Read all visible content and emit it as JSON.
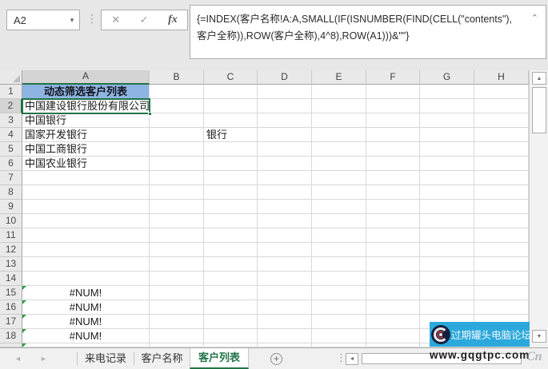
{
  "window": {
    "name_box": "A2"
  },
  "formula_bar": {
    "formula": "{=INDEX(客户名称!A:A,SMALL(IF(ISNUMBER(FIND(CELL(\"contents\"),客户全称)),ROW(客户全称),4^8),ROW(A1)))&\"\"}"
  },
  "sheet": {
    "columns": [
      "A",
      "B",
      "C",
      "D",
      "E",
      "F",
      "G",
      "H"
    ],
    "visible_rows": 18,
    "selected_cell": "A2",
    "selected_column": "A",
    "selected_row": 2,
    "title_cell": "A1",
    "cells": {
      "A1": "动态筛选客户列表",
      "A2": "中国建设银行股份有限公司",
      "A3": "中国银行",
      "A4": "国家开发银行",
      "C4": "银行",
      "A5": "中国工商银行",
      "A6": "中国农业银行",
      "A15": "#NUM!",
      "A16": "#NUM!",
      "A17": "#NUM!",
      "A18": "#NUM!"
    },
    "error_indicator_rows": [
      15,
      16,
      17,
      18,
      19
    ]
  },
  "sheet_tabs": {
    "tabs": [
      {
        "label": "来电记录",
        "active": false
      },
      {
        "label": "客户名称",
        "active": false
      },
      {
        "label": "客户列表",
        "active": true
      }
    ]
  },
  "watermark": {
    "forum_name": "过期罐头电脑论坛",
    "url": "www.gqgtpc.com",
    "corner_badge": "Cn"
  },
  "colors": {
    "accent_green": "#217346",
    "title_fill": "#8DB4E2",
    "watermark_cyan": "#2BA9DC",
    "error_indicator_green": "#2E9E46"
  }
}
